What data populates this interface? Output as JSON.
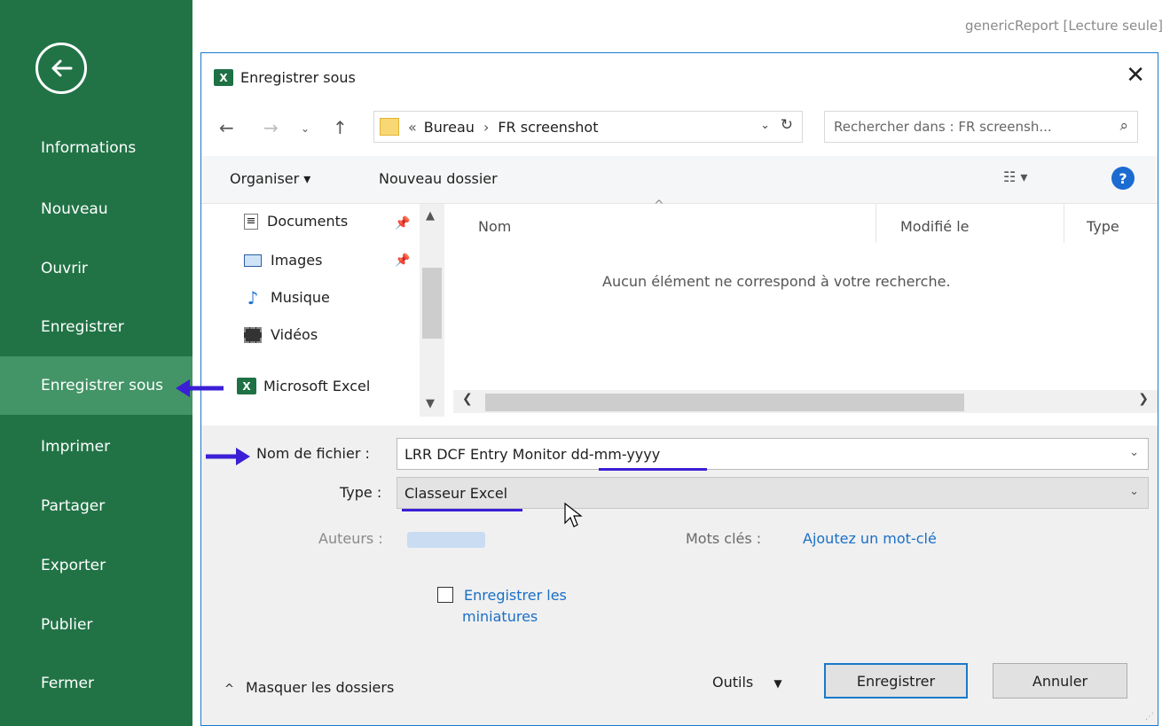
{
  "document": {
    "title": "genericReport  [Lecture seule]"
  },
  "sidebar": {
    "items": [
      {
        "label": "Informations"
      },
      {
        "label": "Nouveau"
      },
      {
        "label": "Ouvrir"
      },
      {
        "label": "Enregistrer"
      },
      {
        "label": "Enregistrer sous",
        "active": true
      },
      {
        "label": "Imprimer"
      },
      {
        "label": "Partager"
      },
      {
        "label": "Exporter"
      },
      {
        "label": "Publier"
      },
      {
        "label": "Fermer"
      }
    ]
  },
  "dialog": {
    "title": "Enregistrer sous",
    "address": {
      "crumbs_prefix": "«",
      "crumb1": "Bureau",
      "separator": "›",
      "crumb2": "FR screenshot"
    },
    "search_placeholder": "Rechercher dans : FR screensh...",
    "toolbar": {
      "organize": "Organiser ▾",
      "new_folder": "Nouveau dossier"
    },
    "nav_pane": {
      "items": [
        {
          "label": "Documents",
          "icon": "documents-icon",
          "pinned": true
        },
        {
          "label": "Images",
          "icon": "images-icon",
          "pinned": true
        },
        {
          "label": "Musique",
          "icon": "music-icon"
        },
        {
          "label": "Vidéos",
          "icon": "videos-icon"
        },
        {
          "label": "Microsoft Excel",
          "icon": "excel-icon"
        }
      ]
    },
    "file_pane": {
      "columns": [
        "Nom",
        "Modifié le",
        "Type"
      ],
      "empty_message": "Aucun élément ne correspond à votre recherche."
    },
    "form": {
      "filename_label": "Nom de fichier :",
      "filename_value": "LRR DCF Entry Monitor dd-mm-yyyy",
      "type_label": "Type :",
      "type_value": "Classeur Excel",
      "authors_label": "Auteurs :",
      "keywords_label": "Mots clés :",
      "keywords_link": "Ajoutez un mot-clé",
      "thumbnails_label_line1": "Enregistrer les",
      "thumbnails_label_line2": "miniatures",
      "thumbnails_checked": false
    },
    "footer": {
      "hide_folders": "Masquer les dossiers",
      "tools": "Outils",
      "save": "Enregistrer",
      "cancel": "Annuler"
    }
  },
  "colors": {
    "excel_green": "#217346",
    "sidebar_active": "#439467",
    "annotation": "#3a1fd6",
    "link": "#1a6fc7"
  }
}
